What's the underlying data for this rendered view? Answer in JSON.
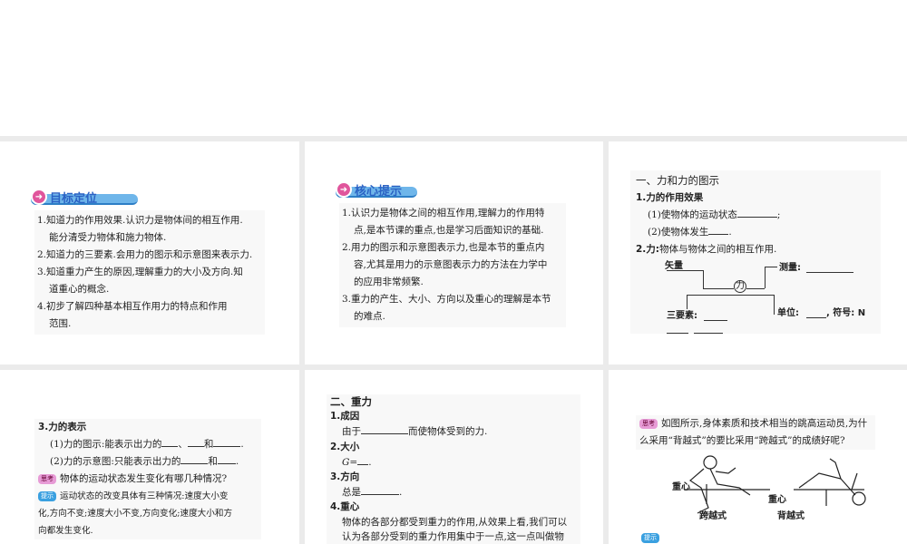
{
  "panel1": {
    "header": "目标定位",
    "items": [
      "1.知道力的作用效果.认识力是物体间的相互作用.",
      "能分清受力物体和施力物体.",
      "2.知道力的三要素.会用力的图示和示意图来表示力.",
      "3.知道重力产生的原因,理解重力的大小及方向.知",
      "道重心的概念.",
      "4.初步了解四种基本相互作用力的特点和作用",
      "范围."
    ]
  },
  "panel2": {
    "header": "核心提示",
    "items": [
      "1.认识力是物体之间的相互作用,理解力的作用特",
      "点,是本节课的重点,也是学习后面知识的基础.",
      "2.用力的图示和示意图表示力,也是本节的重点内",
      "容,尤其是用力的示意图表示力的方法在力学中",
      "的应用非常频繁.",
      "3.重力的产生、大小、方向以及重心的理解是本节",
      "的难点."
    ]
  },
  "panel3": {
    "title": "一、力和力的图示",
    "s1": "1.力的作用效果",
    "s1a": "(1)使物体的运动状态",
    "s1a_end": ";",
    "s1b": "(2)使物体发生",
    "s1b_end": ".",
    "s2_bold": "2.力:",
    "s2": "物体与物体之间的相互作用.",
    "diagram": {
      "center": "力",
      "vector": "矢量",
      "measure": "测量:",
      "elements": "三要素:",
      "unit": "单位:",
      "symbol": ", 符号: N"
    }
  },
  "panel4": {
    "s3": "3.力的表示",
    "l1": "(1)力的图示:能表示出力的",
    "sep1": "、",
    "and1": "和",
    "end1": ".",
    "l2": "(2)力的示意图:只能表示出力的",
    "and2": "和",
    "end2": ".",
    "think_tag": "思考",
    "question": "物体的运动状态发生变化有哪几种情况?",
    "hint_tag": "提示",
    "answer1": "运动状态的改变具体有三种情况:速度大小变",
    "answer2": "化,方向不变;速度大小不变,方向变化;速度大小和方",
    "answer3": "向都发生变化."
  },
  "panel5": {
    "title": "二、重力",
    "h1": "1.成因",
    "t1a": "由于",
    "t1b": "而使物体受到的力.",
    "h2": "2.大小",
    "t2": "G=",
    "t2end": ".",
    "h3": "3.方向",
    "t3": "总是",
    "t3end": ".",
    "h4": "4.重心",
    "t4a": "物体的各部分都受到重力的作用,从效果上看,我们可以",
    "t4b": "认为各部分受到的重力作用集中于一点,这一点叫做物"
  },
  "panel6": {
    "think_tag": "思考",
    "q1": "如图所示,身体素质和技术相当的跳高运动员,为什",
    "q2": "么采用“背越式”的要比采用“跨越式”的成绩好呢?",
    "cg1": "重心",
    "cg2": "重心",
    "cap1": "跨越式",
    "cap2": "背越式",
    "hint_tag": "提示"
  }
}
